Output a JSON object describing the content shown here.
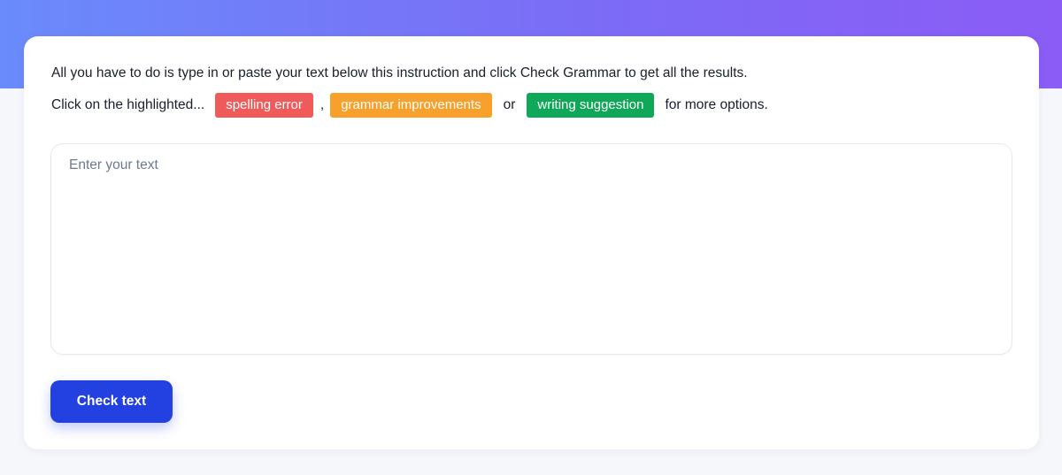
{
  "instructions": {
    "line1": "All you have to do is type in or paste your text below this instruction and click Check Grammar to get all the results.",
    "line2_prefix": "Click on the highlighted...",
    "chip_spelling": "spelling error",
    "separator_comma": ",",
    "chip_grammar": "grammar improvements",
    "separator_or": "or",
    "chip_writing": "writing suggestion",
    "line2_suffix": "for more options."
  },
  "editor": {
    "placeholder": "Enter your text",
    "value": ""
  },
  "actions": {
    "check_label": "Check text"
  },
  "colors": {
    "spelling": "#f05a5b",
    "grammar": "#f7a02b",
    "writing": "#0fa758",
    "primary_button": "#2340e0"
  }
}
